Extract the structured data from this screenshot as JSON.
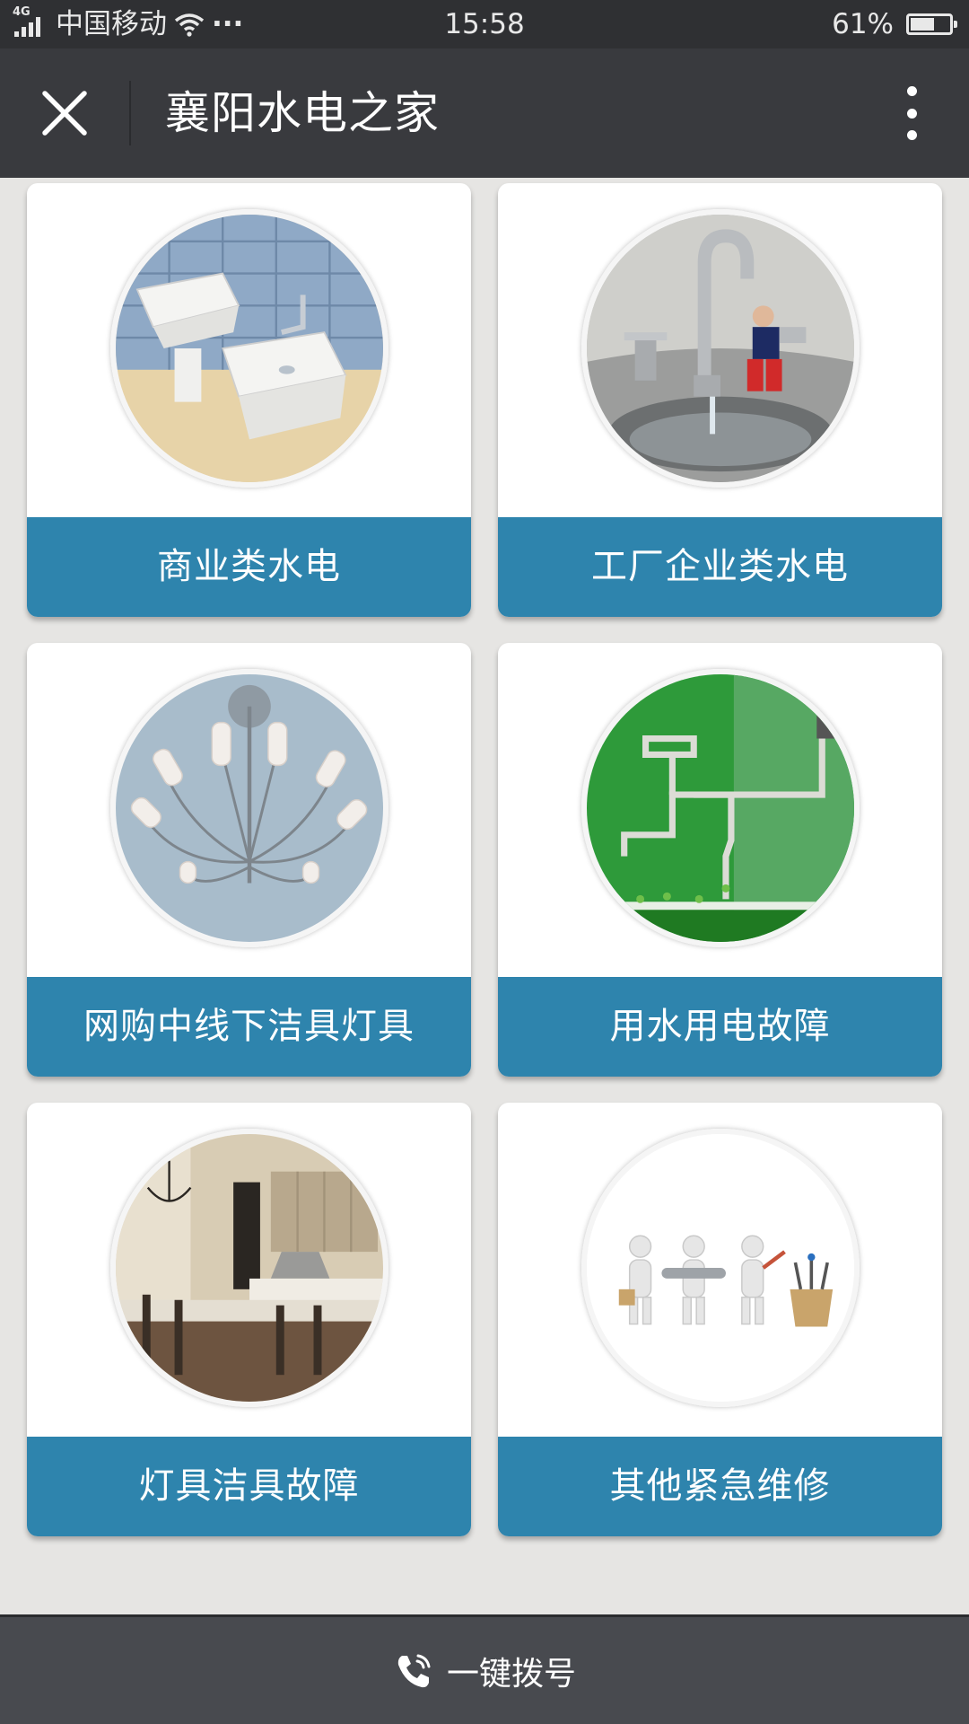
{
  "status_bar": {
    "network_type": "4G",
    "carrier": "中国移动",
    "overflow_dots": "···",
    "time": "15:58",
    "battery_percent": "61%",
    "battery_level": 0.61
  },
  "title_bar": {
    "title": "襄阳水电之家",
    "close_icon": "close-icon",
    "more_icon": "more-vertical-icon"
  },
  "colors": {
    "status_bar": "#2f3033",
    "title_bar": "#393a3e",
    "background": "#e6e5e3",
    "card_label": "#2e84ad",
    "bottom_bar": "#484a4f"
  },
  "services": [
    {
      "label": "商业类水电",
      "image": "bathroom-sinks"
    },
    {
      "label": "工厂企业类水电",
      "image": "faucet-boy"
    },
    {
      "label": "网购中线下洁具灯具",
      "image": "chandelier"
    },
    {
      "label": "用水用电故障",
      "image": "green-wall-faucet"
    },
    {
      "label": "灯具洁具故障",
      "image": "kitchen-interior"
    },
    {
      "label": "其他紧急维修",
      "image": "repair-workers"
    }
  ],
  "bottom_bar": {
    "call_label": "一键拨号",
    "icon": "phone-icon"
  }
}
